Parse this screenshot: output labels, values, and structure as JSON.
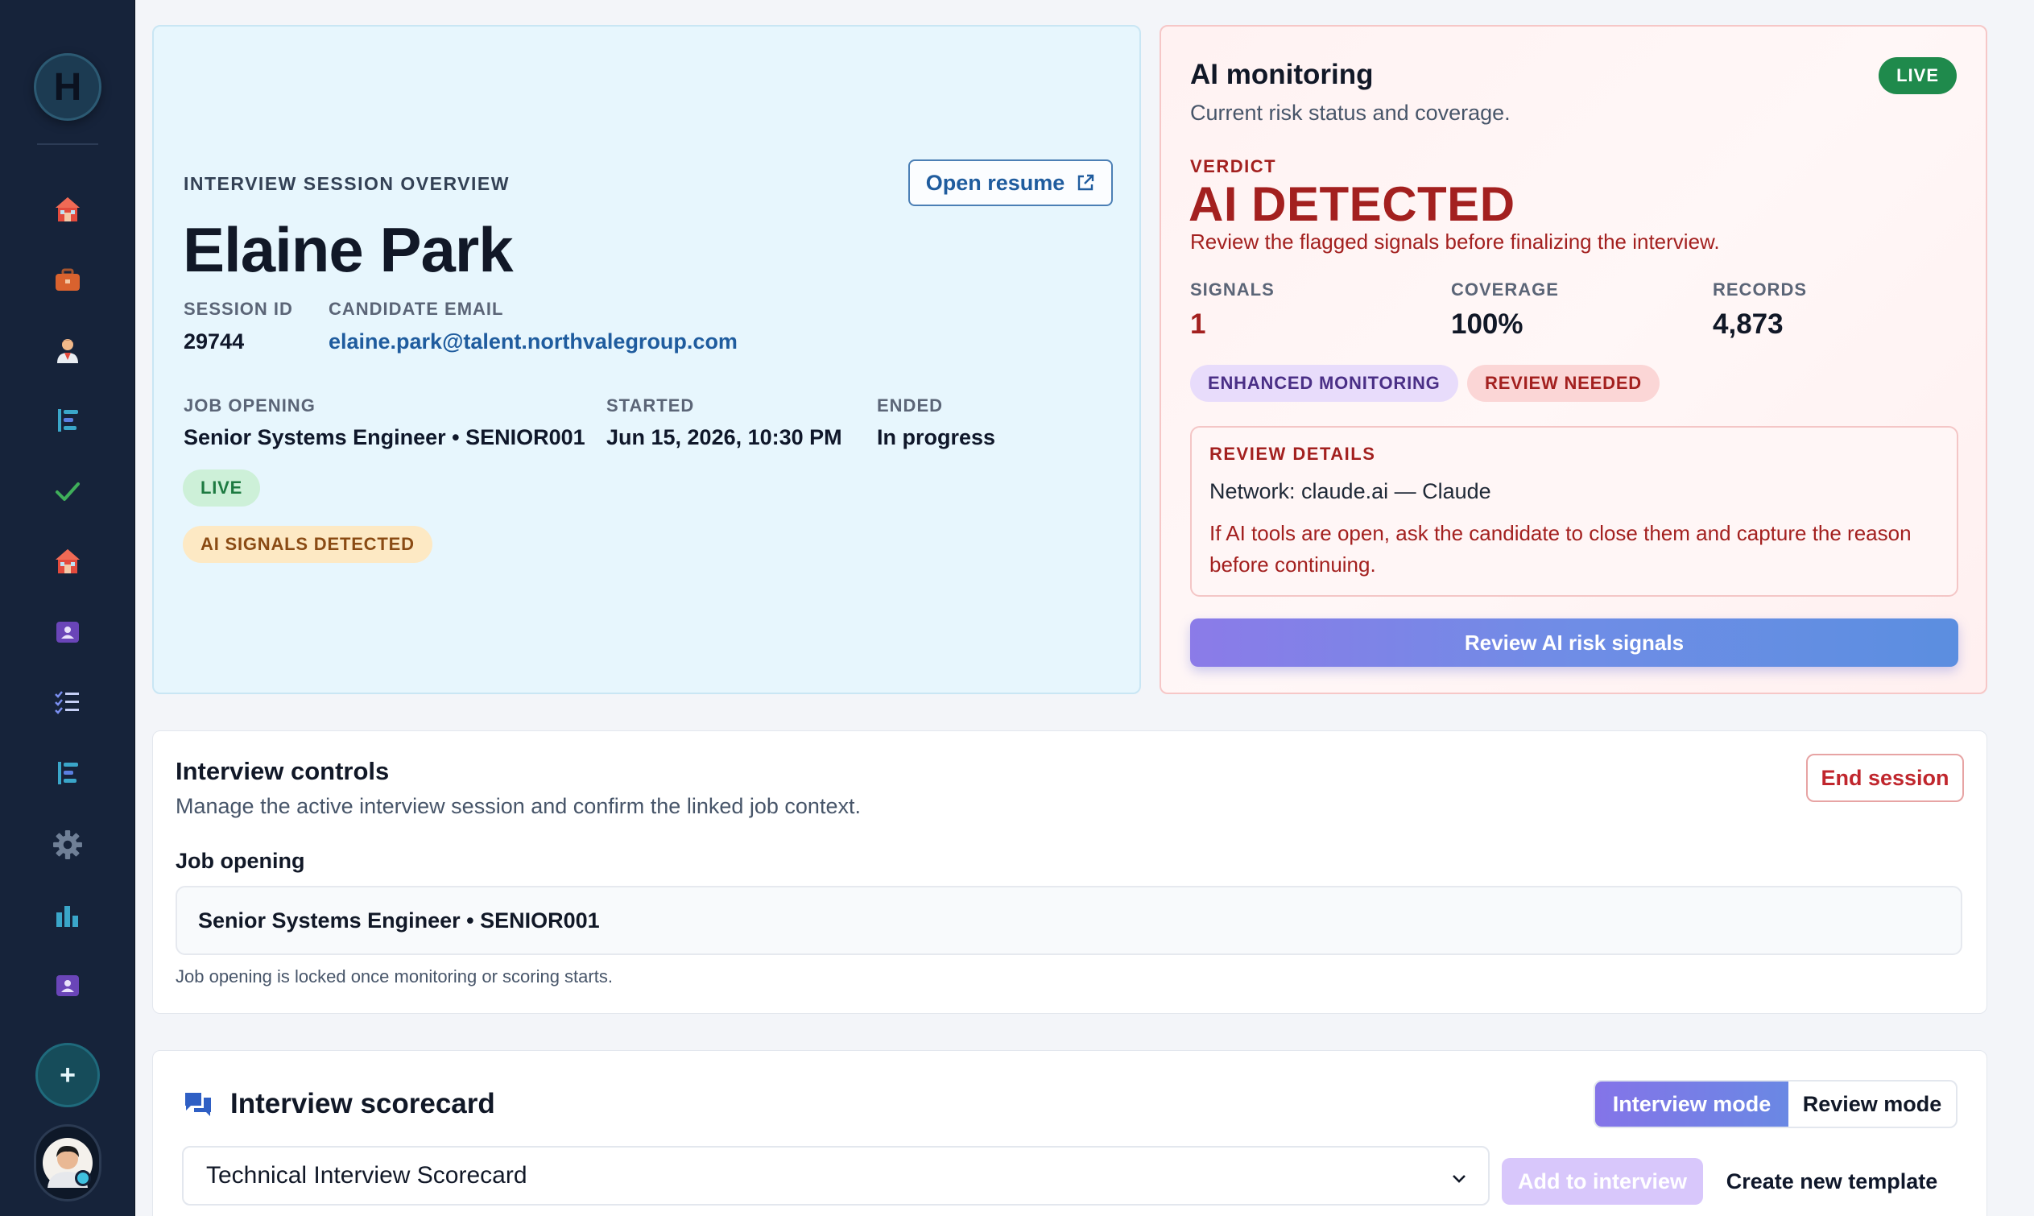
{
  "sidebar": {
    "logo_letter": "H",
    "items": [
      {
        "icon": "home-icon"
      },
      {
        "icon": "briefcase-icon"
      },
      {
        "icon": "person-icon"
      },
      {
        "icon": "pipeline-icon"
      },
      {
        "icon": "check-icon"
      },
      {
        "icon": "home-icon"
      },
      {
        "icon": "contact-card-icon"
      },
      {
        "icon": "checklist-icon"
      },
      {
        "icon": "pipeline-icon"
      },
      {
        "icon": "gear-icon"
      },
      {
        "icon": "bar-chart-icon"
      },
      {
        "icon": "contact-card-icon"
      }
    ],
    "add_label": "+"
  },
  "overview": {
    "eyebrow": "INTERVIEW SESSION OVERVIEW",
    "open_resume": "Open resume",
    "name": "Elaine Park",
    "session_id_label": "SESSION ID",
    "session_id": "29744",
    "email_label": "CANDIDATE EMAIL",
    "email": "elaine.park@talent.northvalegroup.com",
    "job_opening_label": "JOB OPENING",
    "job_opening": "Senior Systems Engineer • SENIOR001",
    "started_label": "STARTED",
    "started": "Jun 15, 2026, 10:30 PM",
    "ended_label": "ENDED",
    "ended": "In progress",
    "status_badge": "LIVE",
    "signals_badge": "AI SIGNALS DETECTED"
  },
  "monitoring": {
    "title": "AI monitoring",
    "subtitle": "Current risk status and coverage.",
    "live_badge": "LIVE",
    "verdict_label": "VERDICT",
    "verdict": "AI DETECTED",
    "verdict_note": "Review the flagged signals before finalizing the interview.",
    "stats": [
      {
        "label": "SIGNALS",
        "value": "1"
      },
      {
        "label": "COVERAGE",
        "value": "100%"
      },
      {
        "label": "RECORDS",
        "value": "4,873"
      }
    ],
    "tags": [
      "ENHANCED MONITORING",
      "REVIEW NEEDED"
    ],
    "review_title": "REVIEW DETAILS",
    "review_network": "Network: claude.ai — Claude",
    "review_advice": "If AI tools are open, ask the candidate to close them and capture the reason before continuing.",
    "review_button": "Review AI risk signals"
  },
  "controls": {
    "title": "Interview controls",
    "subtitle": "Manage the active interview session and confirm the linked job context.",
    "end_session": "End session",
    "job_label": "Job opening",
    "job_value": "Senior Systems Engineer • SENIOR001",
    "job_hint": "Job opening is locked once monitoring or scoring starts."
  },
  "scorecard": {
    "title": "Interview scorecard",
    "mode_interview": "Interview mode",
    "mode_review": "Review mode",
    "template": "Technical Interview Scorecard",
    "add_button": "Add to interview",
    "create_button": "Create new template"
  },
  "colors": {
    "sidebar_bg": "#16233a",
    "verdict_red": "#a3201f",
    "link_blue": "#1f5c9e",
    "live_green": "#1f8a4c",
    "accent_purple": "#7b6fe6"
  }
}
